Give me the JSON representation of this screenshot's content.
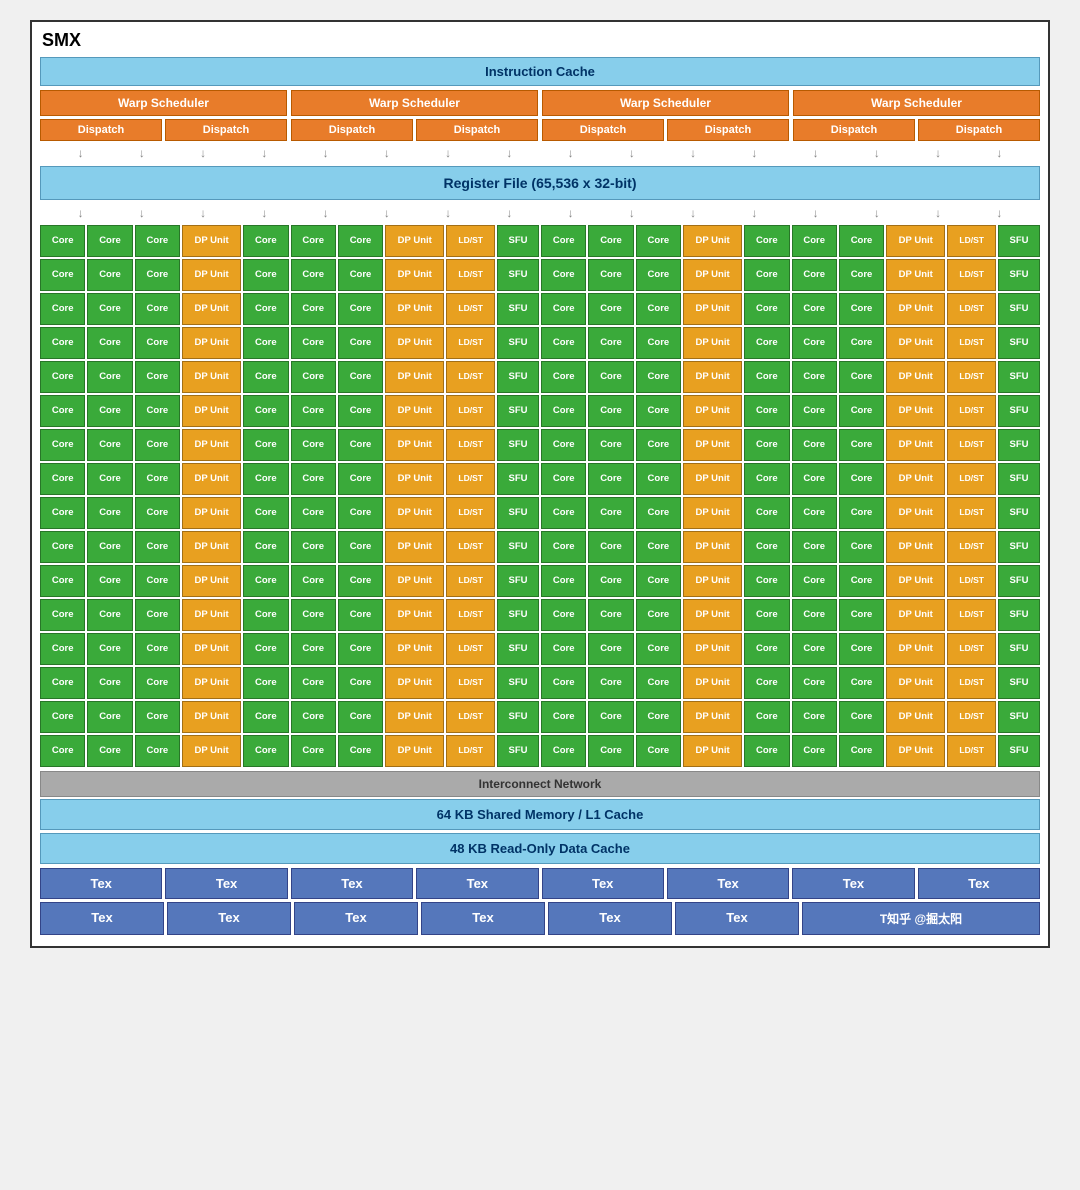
{
  "title": "SMX",
  "instruction_cache": "Instruction Cache",
  "warp_schedulers": [
    "Warp Scheduler",
    "Warp Scheduler",
    "Warp Scheduler",
    "Warp Scheduler"
  ],
  "dispatch_label": "Dispatch",
  "register_file": "Register File (65,536 x 32-bit)",
  "core_rows": 16,
  "interconnect": "Interconnect Network",
  "shared_memory": "64 KB Shared Memory / L1 Cache",
  "readonly_cache": "48 KB Read-Only Data Cache",
  "tex_labels": [
    "Tex",
    "Tex",
    "Tex",
    "Tex",
    "Tex",
    "Tex",
    "Tex",
    "Tex"
  ],
  "tex_labels2": [
    "Tex",
    "Tex",
    "Tex",
    "Tex",
    "Tex",
    "Tex",
    "T知乎 @掘太阳"
  ],
  "cell_types": {
    "core": "Core",
    "dp_unit": "DP Unit",
    "ldst": "LD/ST",
    "sfu": "SFU"
  }
}
